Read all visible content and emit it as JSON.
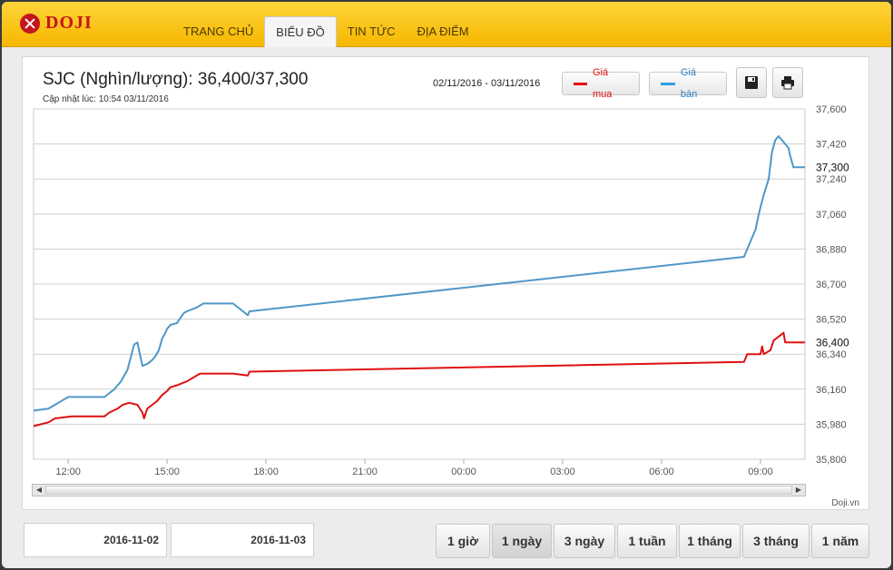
{
  "brand": {
    "name": "DOJI"
  },
  "nav": [
    {
      "label": "TRANG CHỦ"
    },
    {
      "label": "BIỂU ĐỒ"
    },
    {
      "label": "TIN TỨC"
    },
    {
      "label": "ĐỊA ĐIỂM"
    }
  ],
  "chart_header": {
    "title": "SJC (Nghìn/lượng): 36,400/37,300",
    "updated": "Cập nhật lúc: 10:54 03/11/2016",
    "date_range": "02/11/2016 - 03/11/2016",
    "buy_label": "Giá mua",
    "sell_label": "Giá bán",
    "save_icon": "save-icon",
    "print_icon": "print-icon"
  },
  "credit": "Doji.vn",
  "colors": {
    "buy": "#e01010",
    "sell": "#4f97c8",
    "accent": "#f6b700"
  },
  "chart_data": {
    "type": "line",
    "title": "SJC (Nghìn/lượng): 36,400/37,300",
    "xlabel": "",
    "ylabel": "",
    "ylim": [
      35800,
      37600
    ],
    "yticks": [
      35800,
      35980,
      36160,
      36340,
      36520,
      36700,
      36880,
      37060,
      37240,
      37420,
      37600
    ],
    "ytick_labels": [
      "35,800",
      "35,980",
      "36,160",
      "36,340",
      "36,520",
      "36,700",
      "36,880",
      "37,060",
      "37,240",
      "37,420",
      "37,600"
    ],
    "xlim": [
      10.95,
      34.35
    ],
    "xticks": [
      12,
      15,
      18,
      21,
      24,
      27,
      30,
      33
    ],
    "xtick_labels": [
      "12:00",
      "15:00",
      "18:00",
      "21:00",
      "00:00",
      "03:00",
      "06:00",
      "09:00"
    ],
    "grid": true,
    "legend": "top-right",
    "last_value_labels": [
      "36,400",
      "37,300"
    ],
    "series": [
      {
        "name": "Giá mua",
        "color": "#e01010",
        "x": [
          10.95,
          11.4,
          11.6,
          12.1,
          13.1,
          13.25,
          13.5,
          13.65,
          13.85,
          14.1,
          14.25,
          14.3,
          14.4,
          14.55,
          14.7,
          14.85,
          15.0,
          15.1,
          15.3,
          15.6,
          16.0,
          17.0,
          17.45,
          17.5,
          32.5,
          32.6,
          33.0,
          33.05,
          33.1,
          33.3,
          33.4,
          33.7,
          33.75,
          34.35
        ],
        "y": [
          35970,
          35990,
          36010,
          36020,
          36020,
          36040,
          36060,
          36080,
          36090,
          36080,
          36040,
          36010,
          36060,
          36080,
          36100,
          36130,
          36150,
          36170,
          36180,
          36200,
          36240,
          36240,
          36230,
          36250,
          36300,
          36340,
          36340,
          36380,
          36340,
          36360,
          36410,
          36450,
          36400,
          36400
        ]
      },
      {
        "name": "Giá bán",
        "color": "#4f97c8",
        "x": [
          10.95,
          11.4,
          11.6,
          11.8,
          12.0,
          13.1,
          13.25,
          13.4,
          13.5,
          13.6,
          13.7,
          13.8,
          14.0,
          14.1,
          14.25,
          14.4,
          14.55,
          14.65,
          14.75,
          14.85,
          14.95,
          15.0,
          15.1,
          15.3,
          15.5,
          15.6,
          15.9,
          16.1,
          17.0,
          17.3,
          17.45,
          17.5,
          32.5,
          32.6,
          32.85,
          32.95,
          33.1,
          33.25,
          33.35,
          33.45,
          33.55,
          33.85,
          33.9,
          34.0,
          34.35
        ],
        "y": [
          36050,
          36060,
          36080,
          36100,
          36120,
          36120,
          36140,
          36160,
          36180,
          36200,
          36230,
          36260,
          36390,
          36400,
          36280,
          36290,
          36310,
          36330,
          36360,
          36420,
          36450,
          36470,
          36490,
          36500,
          36550,
          36560,
          36580,
          36600,
          36600,
          36560,
          36540,
          36560,
          36840,
          36880,
          36980,
          37060,
          37160,
          37240,
          37380,
          37440,
          37460,
          37400,
          37360,
          37300,
          37300
        ]
      }
    ]
  },
  "footer": {
    "date_from": "2016-11-02",
    "date_to": "2016-11-03",
    "ranges": [
      "1 giờ",
      "1 ngày",
      "3 ngày",
      "1 tuần",
      "1 tháng",
      "3 tháng",
      "1 năm"
    ],
    "active_range": "1 ngày"
  }
}
